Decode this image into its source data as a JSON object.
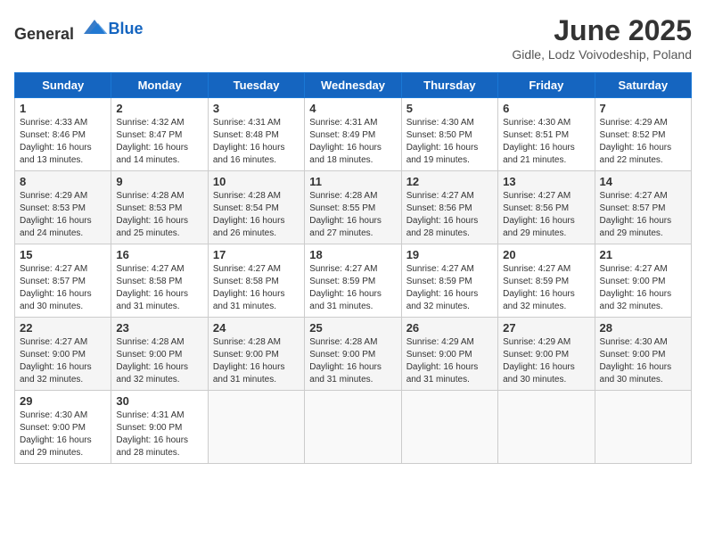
{
  "header": {
    "logo_general": "General",
    "logo_blue": "Blue",
    "month_title": "June 2025",
    "location": "Gidle, Lodz Voivodeship, Poland"
  },
  "weekdays": [
    "Sunday",
    "Monday",
    "Tuesday",
    "Wednesday",
    "Thursday",
    "Friday",
    "Saturday"
  ],
  "weeks": [
    [
      {
        "day": "1",
        "sunrise": "4:33 AM",
        "sunset": "8:46 PM",
        "daylight": "16 hours and 13 minutes."
      },
      {
        "day": "2",
        "sunrise": "4:32 AM",
        "sunset": "8:47 PM",
        "daylight": "16 hours and 14 minutes."
      },
      {
        "day": "3",
        "sunrise": "4:31 AM",
        "sunset": "8:48 PM",
        "daylight": "16 hours and 16 minutes."
      },
      {
        "day": "4",
        "sunrise": "4:31 AM",
        "sunset": "8:49 PM",
        "daylight": "16 hours and 18 minutes."
      },
      {
        "day": "5",
        "sunrise": "4:30 AM",
        "sunset": "8:50 PM",
        "daylight": "16 hours and 19 minutes."
      },
      {
        "day": "6",
        "sunrise": "4:30 AM",
        "sunset": "8:51 PM",
        "daylight": "16 hours and 21 minutes."
      },
      {
        "day": "7",
        "sunrise": "4:29 AM",
        "sunset": "8:52 PM",
        "daylight": "16 hours and 22 minutes."
      }
    ],
    [
      {
        "day": "8",
        "sunrise": "4:29 AM",
        "sunset": "8:53 PM",
        "daylight": "16 hours and 24 minutes."
      },
      {
        "day": "9",
        "sunrise": "4:28 AM",
        "sunset": "8:53 PM",
        "daylight": "16 hours and 25 minutes."
      },
      {
        "day": "10",
        "sunrise": "4:28 AM",
        "sunset": "8:54 PM",
        "daylight": "16 hours and 26 minutes."
      },
      {
        "day": "11",
        "sunrise": "4:28 AM",
        "sunset": "8:55 PM",
        "daylight": "16 hours and 27 minutes."
      },
      {
        "day": "12",
        "sunrise": "4:27 AM",
        "sunset": "8:56 PM",
        "daylight": "16 hours and 28 minutes."
      },
      {
        "day": "13",
        "sunrise": "4:27 AM",
        "sunset": "8:56 PM",
        "daylight": "16 hours and 29 minutes."
      },
      {
        "day": "14",
        "sunrise": "4:27 AM",
        "sunset": "8:57 PM",
        "daylight": "16 hours and 29 minutes."
      }
    ],
    [
      {
        "day": "15",
        "sunrise": "4:27 AM",
        "sunset": "8:57 PM",
        "daylight": "16 hours and 30 minutes."
      },
      {
        "day": "16",
        "sunrise": "4:27 AM",
        "sunset": "8:58 PM",
        "daylight": "16 hours and 31 minutes."
      },
      {
        "day": "17",
        "sunrise": "4:27 AM",
        "sunset": "8:58 PM",
        "daylight": "16 hours and 31 minutes."
      },
      {
        "day": "18",
        "sunrise": "4:27 AM",
        "sunset": "8:59 PM",
        "daylight": "16 hours and 31 minutes."
      },
      {
        "day": "19",
        "sunrise": "4:27 AM",
        "sunset": "8:59 PM",
        "daylight": "16 hours and 32 minutes."
      },
      {
        "day": "20",
        "sunrise": "4:27 AM",
        "sunset": "8:59 PM",
        "daylight": "16 hours and 32 minutes."
      },
      {
        "day": "21",
        "sunrise": "4:27 AM",
        "sunset": "9:00 PM",
        "daylight": "16 hours and 32 minutes."
      }
    ],
    [
      {
        "day": "22",
        "sunrise": "4:27 AM",
        "sunset": "9:00 PM",
        "daylight": "16 hours and 32 minutes."
      },
      {
        "day": "23",
        "sunrise": "4:28 AM",
        "sunset": "9:00 PM",
        "daylight": "16 hours and 32 minutes."
      },
      {
        "day": "24",
        "sunrise": "4:28 AM",
        "sunset": "9:00 PM",
        "daylight": "16 hours and 31 minutes."
      },
      {
        "day": "25",
        "sunrise": "4:28 AM",
        "sunset": "9:00 PM",
        "daylight": "16 hours and 31 minutes."
      },
      {
        "day": "26",
        "sunrise": "4:29 AM",
        "sunset": "9:00 PM",
        "daylight": "16 hours and 31 minutes."
      },
      {
        "day": "27",
        "sunrise": "4:29 AM",
        "sunset": "9:00 PM",
        "daylight": "16 hours and 30 minutes."
      },
      {
        "day": "28",
        "sunrise": "4:30 AM",
        "sunset": "9:00 PM",
        "daylight": "16 hours and 30 minutes."
      }
    ],
    [
      {
        "day": "29",
        "sunrise": "4:30 AM",
        "sunset": "9:00 PM",
        "daylight": "16 hours and 29 minutes."
      },
      {
        "day": "30",
        "sunrise": "4:31 AM",
        "sunset": "9:00 PM",
        "daylight": "16 hours and 28 minutes."
      },
      null,
      null,
      null,
      null,
      null
    ]
  ],
  "labels": {
    "sunrise_prefix": "Sunrise: ",
    "sunset_prefix": "Sunset: ",
    "daylight_prefix": "Daylight: "
  }
}
